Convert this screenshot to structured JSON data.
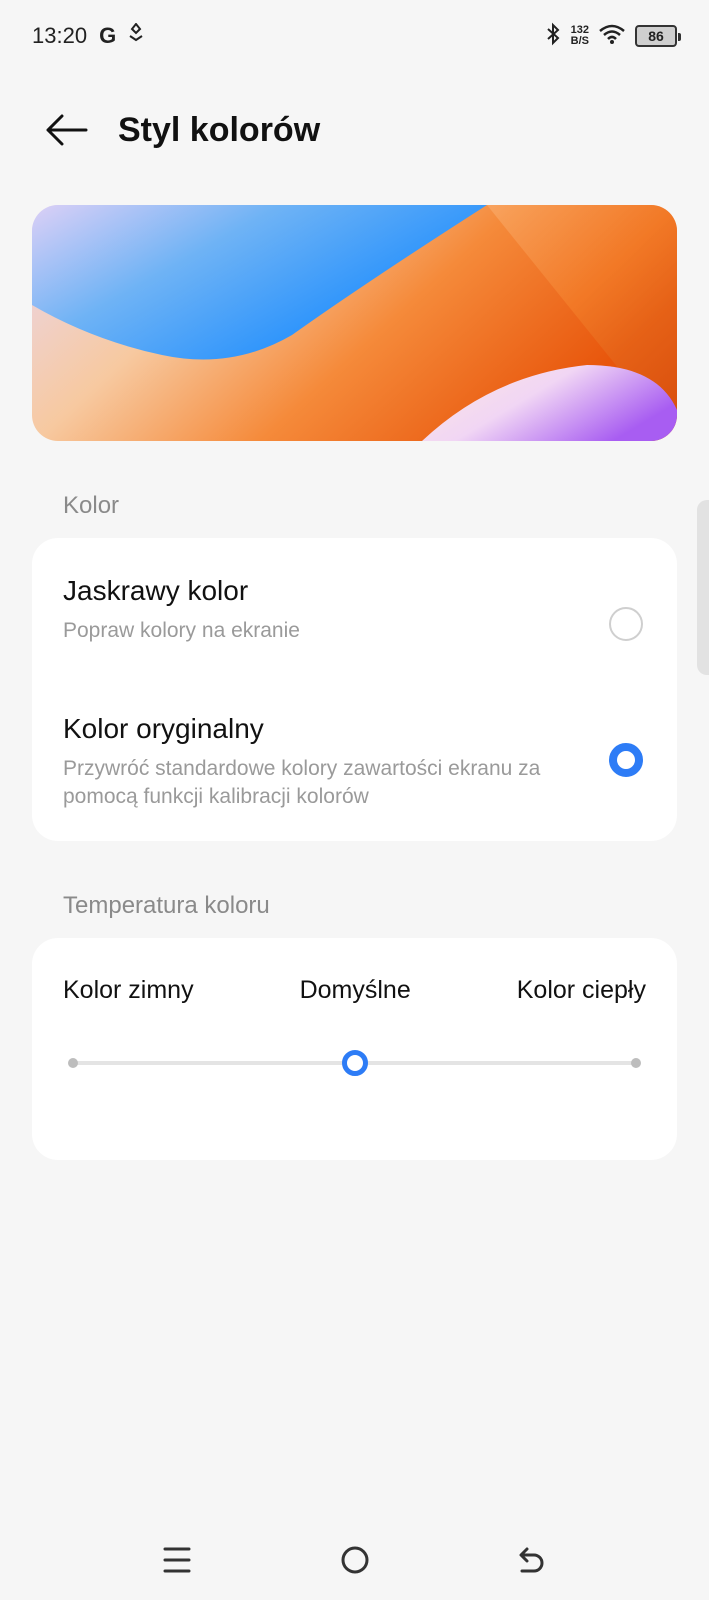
{
  "status_bar": {
    "time": "13:20",
    "g_letter": "G",
    "net_speed_value": "132",
    "net_speed_unit": "B/S",
    "battery": "86"
  },
  "header": {
    "title": "Styl kolorów"
  },
  "color_section": {
    "label": "Kolor",
    "options": [
      {
        "title": "Jaskrawy kolor",
        "subtitle": "Popraw kolory na ekranie",
        "selected": false
      },
      {
        "title": "Kolor oryginalny",
        "subtitle": "Przywróć standardowe kolory zawartości ekranu za pomocą funkcji kalibracji kolorów",
        "selected": true
      }
    ]
  },
  "temperature_section": {
    "label": "Temperatura koloru",
    "cold_label": "Kolor zimny",
    "default_label": "Domyślne",
    "warm_label": "Kolor ciepły",
    "slider_value_percent": 50
  },
  "accent_color": "#2d7cf6",
  "icons": {
    "back": "arrow-left-icon",
    "menu": "menu-icon",
    "home": "home-circle-icon",
    "return": "return-icon"
  }
}
